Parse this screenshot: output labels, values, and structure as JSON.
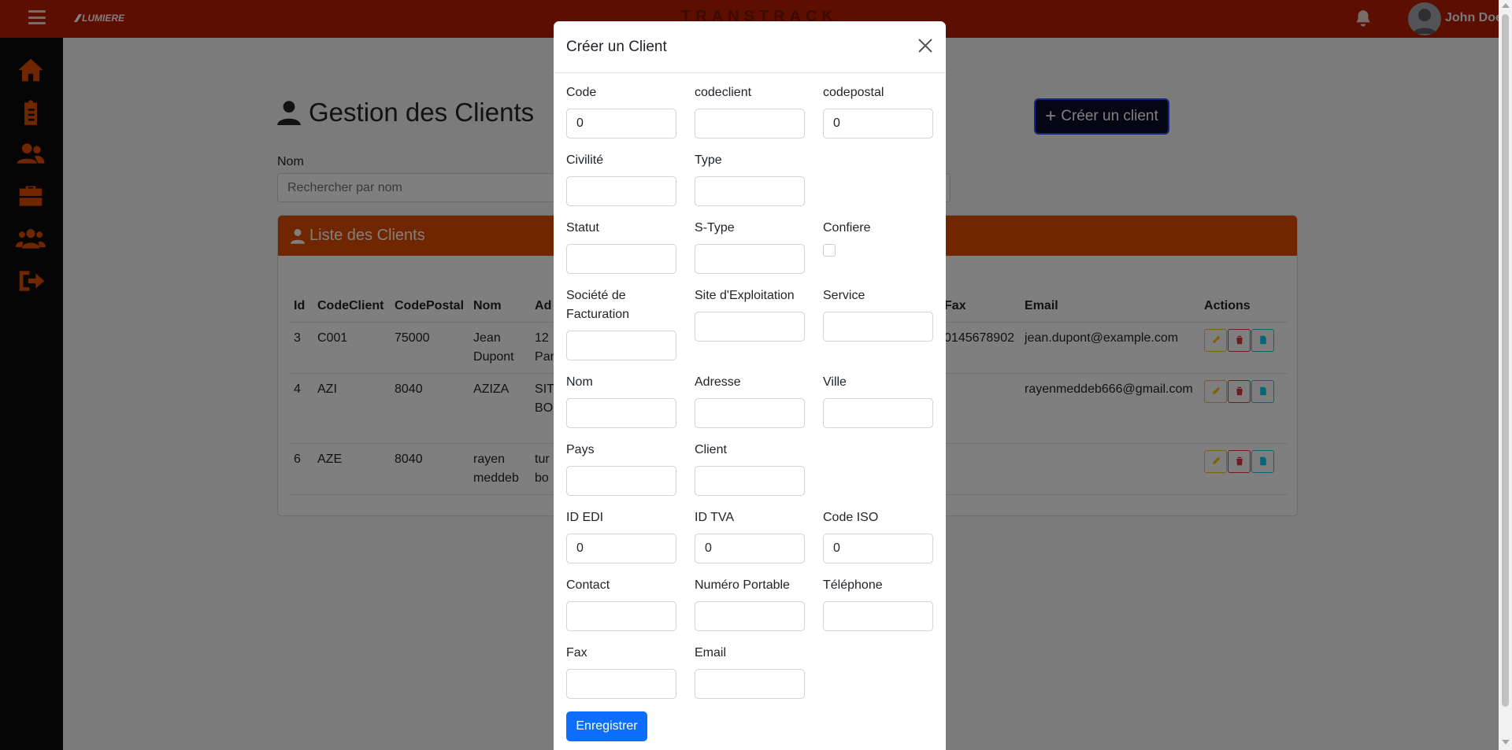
{
  "topbar": {
    "brand_logo": "LUMIERE",
    "app_title": "TRANSTRACK",
    "user_name": "John Doe",
    "colors": {
      "bar": "#b81c01",
      "sidebar": "#0b0b0b",
      "accent": "#e04e00"
    }
  },
  "sidebar": {
    "items": [
      {
        "icon": "home-icon"
      },
      {
        "icon": "clipboard-icon"
      },
      {
        "icon": "users-icon"
      },
      {
        "icon": "briefcase-icon"
      },
      {
        "icon": "user-group-icon"
      },
      {
        "icon": "logout-icon"
      }
    ]
  },
  "page": {
    "title": "Gestion des Clients",
    "create_button": "Créer un client",
    "search_label": "Nom",
    "search_placeholder": "Rechercher par nom",
    "list_title": "Liste des Clients"
  },
  "table": {
    "headers": [
      "Id",
      "CodeClient",
      "CodePostal",
      "Nom",
      "Ad",
      "Fax",
      "Email",
      "Actions"
    ],
    "rows": [
      {
        "id": "3",
        "code": "C001",
        "postal": "75000",
        "nom_1": "Jean",
        "nom_2": "Dupont",
        "adr_1": "12",
        "adr_2": "Par",
        "fax": "0145678902",
        "email": "jean.dupont@example.com"
      },
      {
        "id": "4",
        "code": "AZI",
        "postal": "8040",
        "nom_1": "AZIZA",
        "nom_2": "",
        "adr_1": "SIT",
        "adr_2": "BO",
        "fax": "",
        "email": "rayenmeddeb666@gmail.com"
      },
      {
        "id": "6",
        "code": "AZE",
        "postal": "8040",
        "nom_1": "rayen",
        "nom_2": "meddeb",
        "adr_1": "tur",
        "adr_2": "bo",
        "fax": "",
        "email": ""
      }
    ]
  },
  "modal": {
    "title": "Créer un Client",
    "save_button": "Enregistrer",
    "fields": {
      "code": {
        "label": "Code",
        "value": "0"
      },
      "codeclient": {
        "label": "codeclient",
        "value": ""
      },
      "codepostal": {
        "label": "codepostal",
        "value": "0"
      },
      "civilite": {
        "label": "Civilité",
        "value": ""
      },
      "type": {
        "label": "Type",
        "value": ""
      },
      "statut": {
        "label": "Statut",
        "value": ""
      },
      "stype": {
        "label": "S-Type",
        "value": ""
      },
      "confiere": {
        "label": "Confiere",
        "checked": false
      },
      "societe": {
        "label": "Société de Facturation",
        "value": ""
      },
      "site": {
        "label": "Site d'Exploitation",
        "value": ""
      },
      "service": {
        "label": "Service",
        "value": ""
      },
      "nom": {
        "label": "Nom",
        "value": ""
      },
      "adresse": {
        "label": "Adresse",
        "value": ""
      },
      "ville": {
        "label": "Ville",
        "value": ""
      },
      "pays": {
        "label": "Pays",
        "value": ""
      },
      "client": {
        "label": "Client",
        "value": ""
      },
      "idedi": {
        "label": "ID EDI",
        "value": "0"
      },
      "idtva": {
        "label": "ID TVA",
        "value": "0"
      },
      "codeiso": {
        "label": "Code ISO",
        "value": "0"
      },
      "contact": {
        "label": "Contact",
        "value": ""
      },
      "portable": {
        "label": "Numéro Portable",
        "value": ""
      },
      "telephone": {
        "label": "Téléphone",
        "value": ""
      },
      "fax": {
        "label": "Fax",
        "value": ""
      },
      "email": {
        "label": "Email",
        "value": ""
      }
    }
  }
}
